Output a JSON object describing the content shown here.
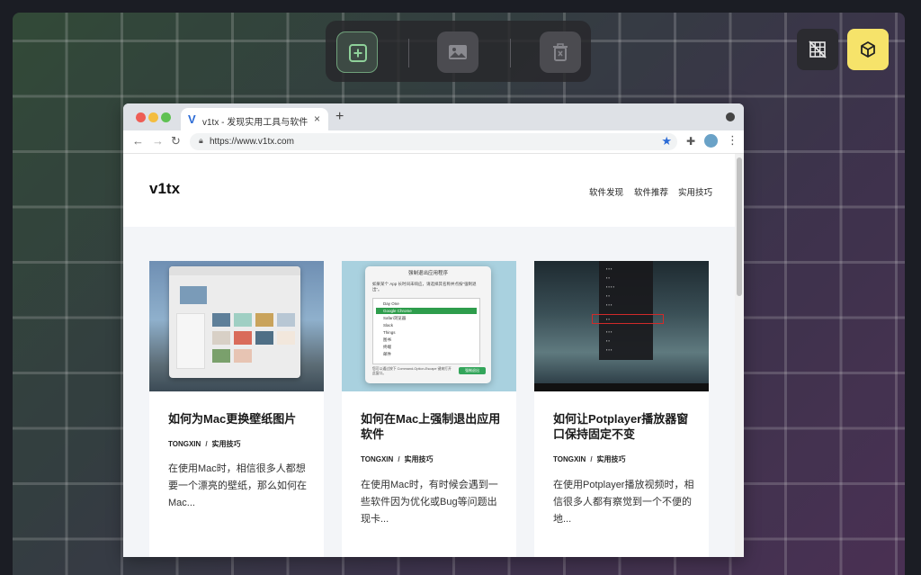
{
  "toolbar": {
    "add_icon": "plus-square-icon",
    "image_icon": "image-icon",
    "delete_icon": "trash-icon"
  },
  "right_buttons": {
    "grid_icon": "grid-off-icon",
    "box_icon": "cube-icon",
    "active_color": "#f6e36a"
  },
  "browser": {
    "tab_favicon": "V",
    "tab_title": "v1tx - 发现实用工具与软件",
    "tab_close": "×",
    "new_tab": "+",
    "url": "https://www.v1tx.com"
  },
  "site": {
    "logo": "v1tx",
    "nav": [
      "软件发现",
      "软件推荐",
      "实用技巧"
    ]
  },
  "posts": [
    {
      "title": "如何为Mac更换壁纸图片",
      "author": "TONGXIN",
      "category": "实用技巧",
      "excerpt": "在使用Mac时，相信很多人都想要一个漂亮的壁纸，那么如何在Mac..."
    },
    {
      "title": "如何在Mac上强制退出应用软件",
      "author": "TONGXIN",
      "category": "实用技巧",
      "excerpt": "在使用Mac时，有时候会遇到一些软件因为优化或Bug等问题出现卡..."
    },
    {
      "title": "如何让Potplayer播放器窗口保持固定不变",
      "author": "TONGXIN",
      "category": "实用技巧",
      "excerpt": "在使用Potplayer播放视频时，相信很多人都有察觉到一个不便的地..."
    }
  ],
  "thumb2": {
    "title": "强制退出应用程序",
    "desc": "如果某个 App 长时间未响应，请选择其名称并点按“强制退出”。",
    "items": [
      "Day One",
      "Google Chrome",
      "Safari浏览器",
      "Slack",
      "Things",
      "图书",
      "终端",
      "邮件"
    ],
    "footer": "您可以通过按下 Command-Option-Escape 键来打开此窗口。",
    "button": "强制退出"
  }
}
